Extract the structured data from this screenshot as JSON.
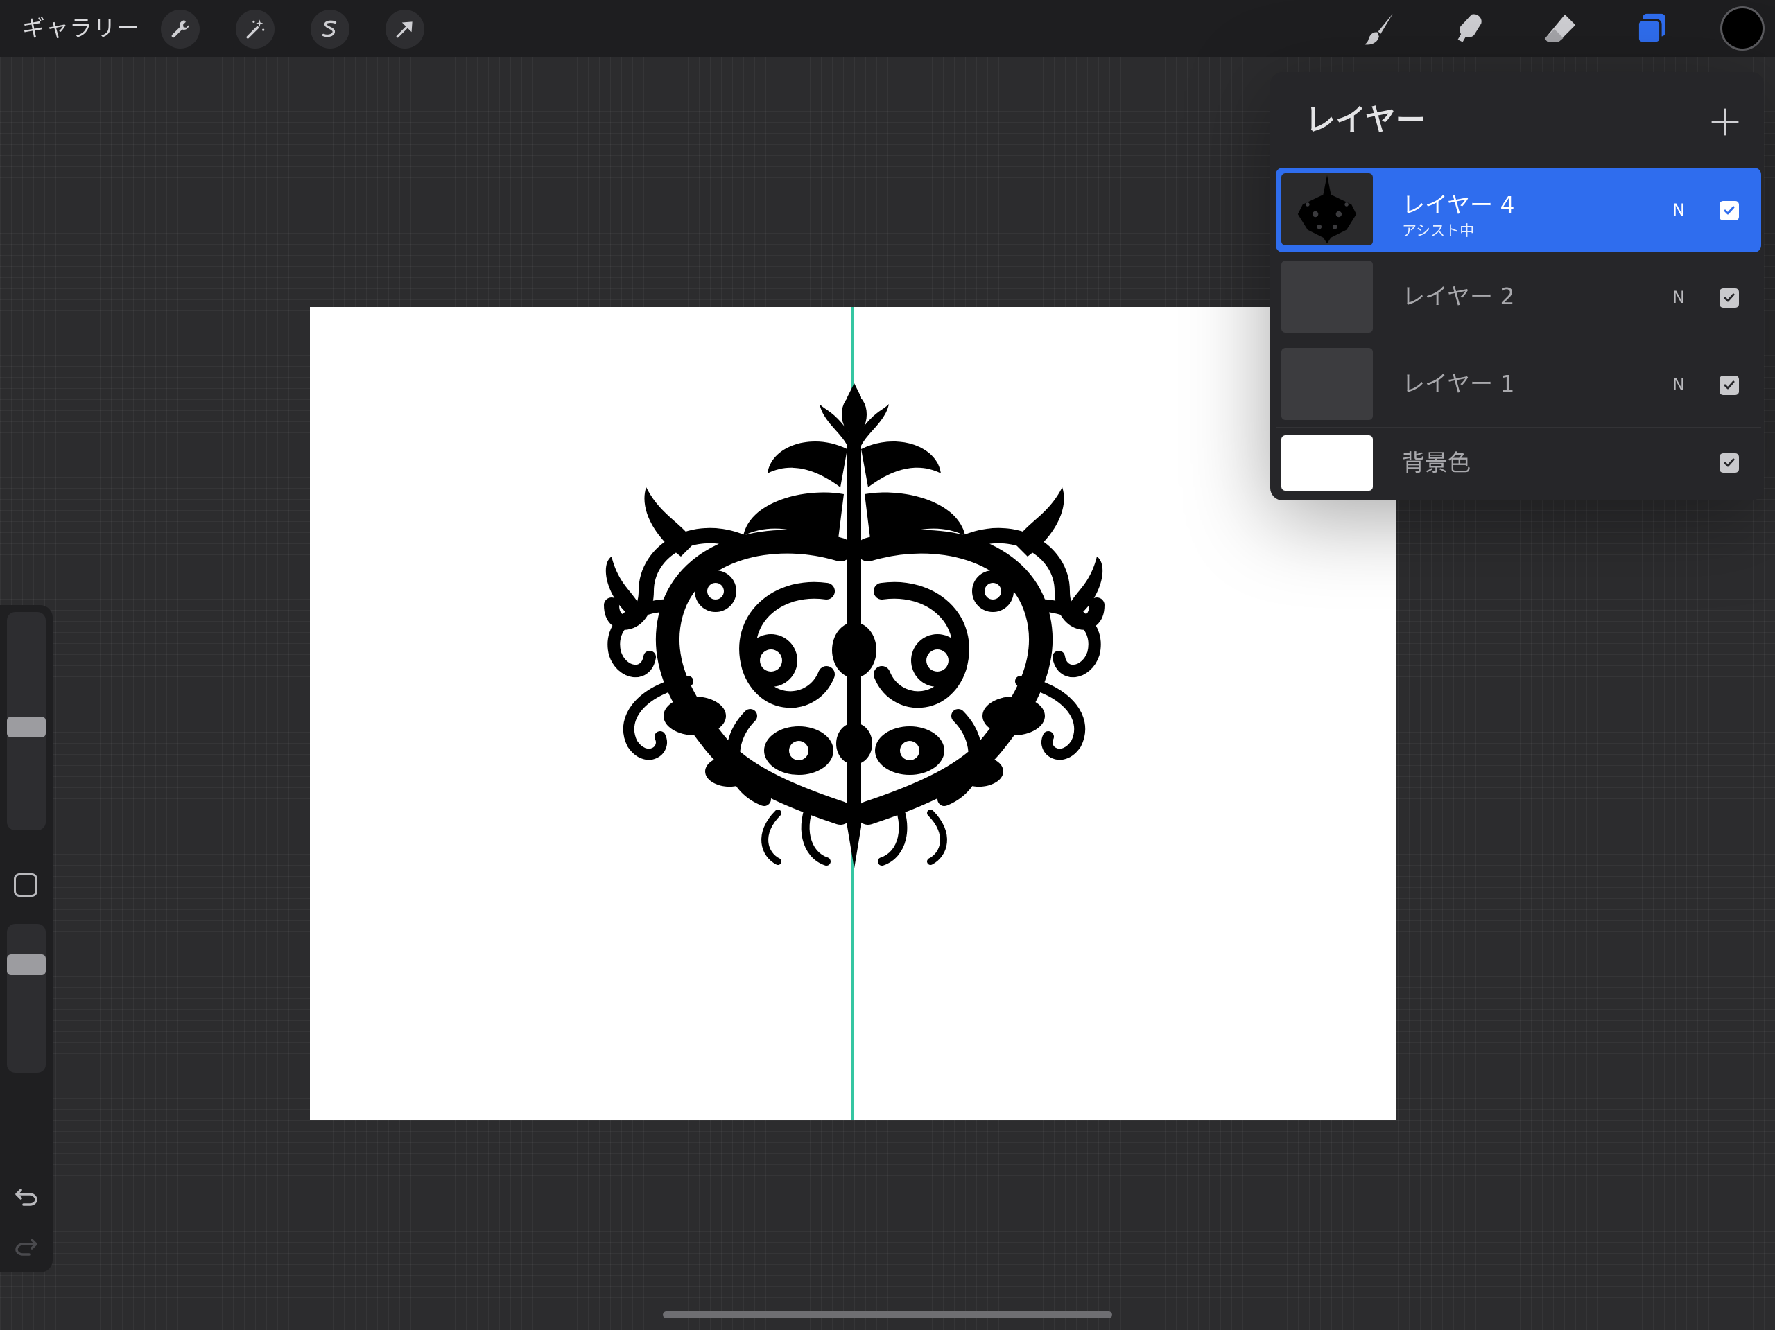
{
  "toolbar": {
    "gallery_label": "ギャラリー",
    "left_tools": [
      "wrench-icon",
      "magic-wand-icon",
      "selection-s-icon",
      "transform-arrow-icon"
    ],
    "right_tools": [
      "brush-icon",
      "smudge-icon",
      "eraser-icon",
      "layers-icon"
    ],
    "active_tool": "layers-icon",
    "accent_color": "#2f6dee",
    "current_color": "#000000"
  },
  "canvas": {
    "background_color": "#ffffff",
    "symmetry_guide_color": "#35c6a2",
    "artwork": "black damask ornament"
  },
  "sidebar": {
    "brush_size_level": 0.47,
    "opacity_level": 0.76,
    "undo_icon": "undo-arrow-icon",
    "redo_icon": "redo-arrow-icon"
  },
  "layers_panel": {
    "title": "レイヤー",
    "add_icon": "plus-icon",
    "layers": [
      {
        "name": "レイヤー 4",
        "subtitle": "アシスト中",
        "blend": "N",
        "visible": true,
        "selected": true
      },
      {
        "name": "レイヤー 2",
        "blend": "N",
        "visible": true,
        "selected": false
      },
      {
        "name": "レイヤー 1",
        "blend": "N",
        "visible": true,
        "selected": false
      },
      {
        "name": "背景色",
        "blend": "",
        "visible": true,
        "selected": false
      }
    ]
  }
}
